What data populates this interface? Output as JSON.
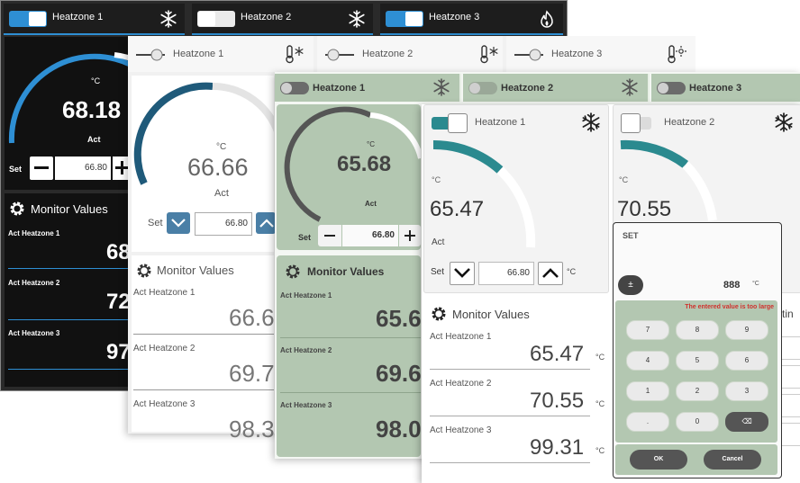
{
  "dark": {
    "zones": [
      {
        "label": "Heatzone 1",
        "icon": "snowflake-icon",
        "on": true
      },
      {
        "label": "Heatzone 2",
        "icon": "snowflake-icon",
        "on": false
      },
      {
        "label": "Heatzone 3",
        "icon": "flame-icon",
        "on": true
      }
    ],
    "unit": "°C",
    "act_value": "68.18",
    "act_label": "Act",
    "set_label": "Set",
    "set_value": "66.80",
    "monitor_title": "Monitor Values",
    "monitor": [
      {
        "label": "Act Heatzone 1",
        "value": "68"
      },
      {
        "label": "Act Heatzone 2",
        "value": "72"
      },
      {
        "label": "Act Heatzone 3",
        "value": "97"
      }
    ],
    "accent": "#2e8fd4"
  },
  "light": {
    "zones": [
      {
        "label": "Heatzone 1",
        "icon": "thermometer-snow-icon"
      },
      {
        "label": "Heatzone 2",
        "icon": "thermometer-snow-icon"
      },
      {
        "label": "Heatzone 3",
        "icon": "thermometer-sun-icon"
      }
    ],
    "unit": "°C",
    "act_value": "66.66",
    "act_label": "Act",
    "set_label": "Set",
    "set_value": "66.80",
    "monitor_title": "Monitor Values",
    "monitor": [
      {
        "label": "Act Heatzone 1",
        "value": "66.6"
      },
      {
        "label": "Act Heatzone 2",
        "value": "69.7"
      },
      {
        "label": "Act Heatzone 3",
        "value": "98.3"
      }
    ],
    "accent": "#1f5a7a"
  },
  "green": {
    "zones": [
      {
        "label": "Heatzone 1",
        "icon": "snowflake-icon"
      },
      {
        "label": "Heatzone 2",
        "icon": "snowflake-icon"
      },
      {
        "label": "Heatzone 3",
        "icon": "snowflake-icon"
      }
    ],
    "unit": "°C",
    "act_value": "65.68",
    "act_label": "Act",
    "set_label": "Set",
    "set_value": "66.80",
    "monitor_title": "Monitor Values",
    "monitor": [
      {
        "label": "Act Heatzone 1",
        "value": "65.6"
      },
      {
        "label": "Act Heatzone 2",
        "value": "69.6"
      },
      {
        "label": "Act Heatzone 3",
        "value": "98.0"
      }
    ],
    "accent": "#b3c7b1"
  },
  "white": {
    "zones": [
      {
        "label": "Heatzone 1",
        "icon": "snowflake-icon",
        "on": true
      },
      {
        "label": "Heatzone 2",
        "icon": "snowflake-icon",
        "on": false
      }
    ],
    "unit": "°C",
    "act_value_1": "65.47",
    "act_value_2": "70.55",
    "act_label": "Act",
    "set_label": "Set",
    "set_value": "66.80",
    "monitor_title": "Monitor Values",
    "settings_partial": "ettin",
    "monitor": [
      {
        "label": "Act Heatzone 1",
        "value": "65.47",
        "unit": "°C"
      },
      {
        "label": "Act Heatzone 2",
        "value": "70.55",
        "unit": "°C"
      },
      {
        "label": "Act Heatzone 3",
        "value": "99.31",
        "unit": "°C"
      }
    ],
    "accent": "#2b8a8f"
  },
  "keypad": {
    "title": "SET",
    "entered_value": "888",
    "unit": "°C",
    "sign_key": "±",
    "error": "The entered value is too large",
    "keys": [
      "7",
      "8",
      "9",
      "4",
      "5",
      "6",
      "1",
      "2",
      "3",
      ".",
      "0",
      "⌫"
    ],
    "ok": "OK",
    "cancel": "Cancel"
  }
}
